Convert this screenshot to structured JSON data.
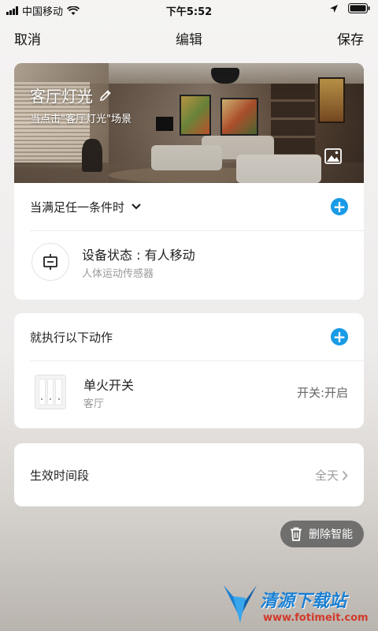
{
  "status_bar": {
    "carrier": "中国移动",
    "time": "下午5:52"
  },
  "nav": {
    "cancel": "取消",
    "title": "编辑",
    "save": "保存"
  },
  "scene": {
    "name": "客厅灯光",
    "subtitle": "当点击\"客厅灯光\"场景"
  },
  "condition": {
    "header": "当满足任一条件时",
    "add_icon": "plus-icon",
    "device_title": "设备状态 : 有人移动",
    "device_sub": "人体运动传感器"
  },
  "action": {
    "header": "就执行以下动作",
    "device_title": "单火开关",
    "device_sub": "客厅",
    "state": "开关:开启"
  },
  "time_period": {
    "label": "生效时间段",
    "value": "全天"
  },
  "delete_button": "删除智能",
  "watermark": {
    "text": "清源下载站",
    "url": "www.fotimeit.com"
  },
  "colors": {
    "accent": "#1a9be6"
  }
}
